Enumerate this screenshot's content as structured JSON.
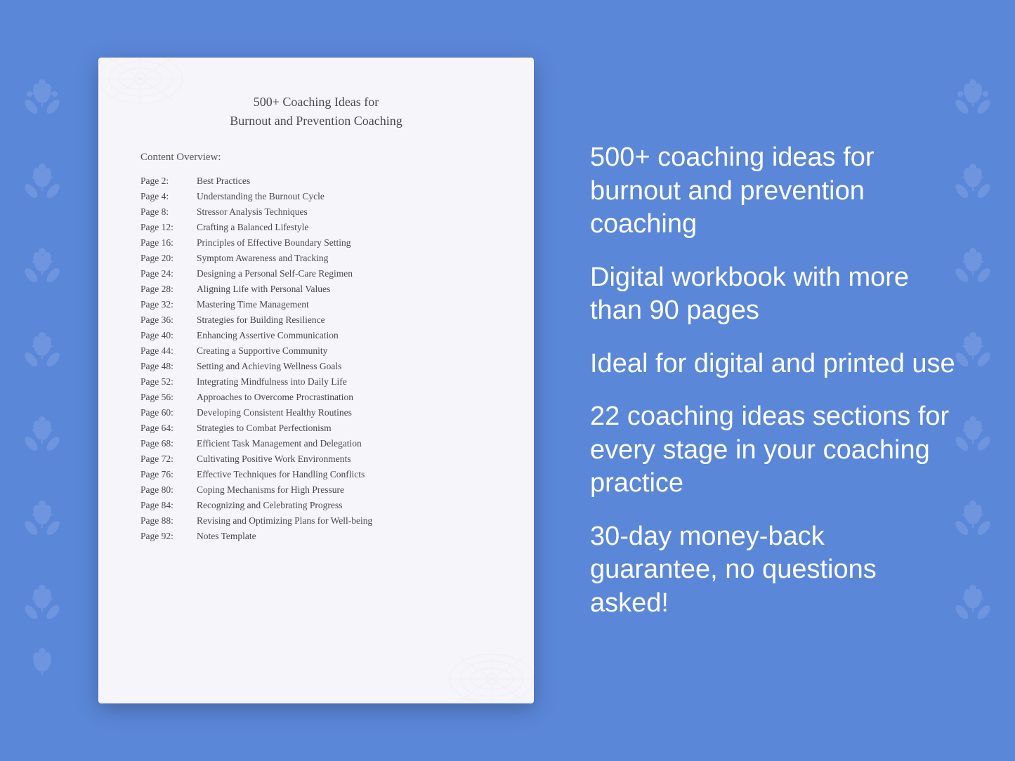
{
  "background": {
    "color": "#5b87d9"
  },
  "document": {
    "title_line1": "500+ Coaching Ideas for",
    "title_line2": "Burnout and Prevention Coaching",
    "section_label": "Content Overview:",
    "toc_items": [
      {
        "page": "Page  2:",
        "text": "Best Practices"
      },
      {
        "page": "Page  4:",
        "text": "Understanding the Burnout Cycle"
      },
      {
        "page": "Page  8:",
        "text": "Stressor Analysis Techniques"
      },
      {
        "page": "Page 12:",
        "text": "Crafting a Balanced Lifestyle"
      },
      {
        "page": "Page 16:",
        "text": "Principles of Effective Boundary Setting"
      },
      {
        "page": "Page 20:",
        "text": "Symptom Awareness and Tracking"
      },
      {
        "page": "Page 24:",
        "text": "Designing a Personal Self-Care Regimen"
      },
      {
        "page": "Page 28:",
        "text": "Aligning Life with Personal Values"
      },
      {
        "page": "Page 32:",
        "text": "Mastering Time Management"
      },
      {
        "page": "Page 36:",
        "text": "Strategies for Building Resilience"
      },
      {
        "page": "Page 40:",
        "text": "Enhancing Assertive Communication"
      },
      {
        "page": "Page 44:",
        "text": "Creating a Supportive Community"
      },
      {
        "page": "Page 48:",
        "text": "Setting and Achieving Wellness Goals"
      },
      {
        "page": "Page 52:",
        "text": "Integrating Mindfulness into Daily Life"
      },
      {
        "page": "Page 56:",
        "text": "Approaches to Overcome Procrastination"
      },
      {
        "page": "Page 60:",
        "text": "Developing Consistent Healthy Routines"
      },
      {
        "page": "Page 64:",
        "text": "Strategies to Combat Perfectionism"
      },
      {
        "page": "Page 68:",
        "text": "Efficient Task Management and Delegation"
      },
      {
        "page": "Page 72:",
        "text": "Cultivating Positive Work Environments"
      },
      {
        "page": "Page 76:",
        "text": "Effective Techniques for Handling Conflicts"
      },
      {
        "page": "Page 80:",
        "text": "Coping Mechanisms for High Pressure"
      },
      {
        "page": "Page 84:",
        "text": "Recognizing and Celebrating Progress"
      },
      {
        "page": "Page 88:",
        "text": "Revising and Optimizing Plans for Well-being"
      },
      {
        "page": "Page 92:",
        "text": "Notes Template"
      }
    ]
  },
  "features": [
    "500+ coaching ideas for burnout and prevention coaching",
    "Digital workbook with more than 90 pages",
    "Ideal for digital and printed use",
    "22 coaching ideas sections for every stage in your coaching practice",
    "30-day money-back guarantee, no questions asked!"
  ]
}
